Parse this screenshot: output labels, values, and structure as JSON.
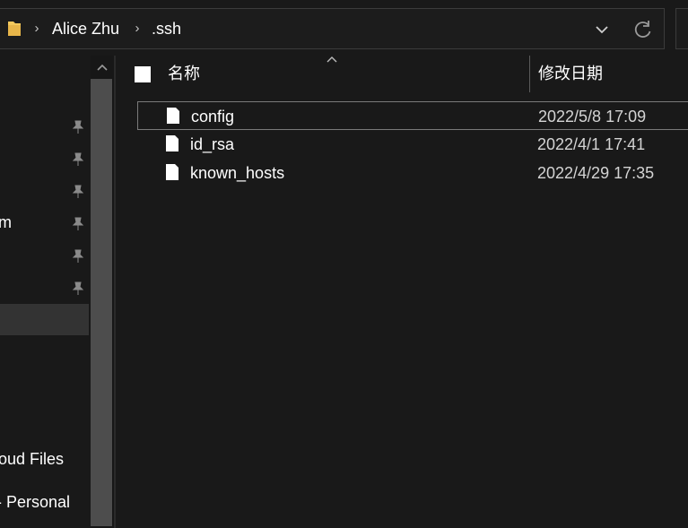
{
  "address_bar": {
    "icon": "folder-icon",
    "breadcrumbs": [
      "Alice Zhu",
      ".ssh"
    ],
    "dropdown_icon": "chevron-down-icon",
    "refresh_icon": "refresh-icon"
  },
  "nav_pane": {
    "visible_labels": {
      "truncated_item": "m",
      "cloud_files": "oud Files",
      "personal": "- Personal"
    },
    "pinned_icon": "pin-icon",
    "pinned_count": 6,
    "scroll_up_icon": "chevron-up-icon"
  },
  "file_list": {
    "columns": {
      "name": "名称",
      "date_modified": "修改日期"
    },
    "sorted_by": "name",
    "files": [
      {
        "name": "config",
        "date": "2022/5/8 17:09",
        "icon": "file-icon",
        "selected": true
      },
      {
        "name": "id_rsa",
        "date": "2022/4/1 17:41",
        "icon": "file-icon",
        "selected": false
      },
      {
        "name": "known_hosts",
        "date": "2022/4/29 17:35",
        "icon": "file-icon",
        "selected": false
      }
    ]
  },
  "colors": {
    "background": "#191919",
    "selection_border": "#7a7a7a",
    "nav_selected": "#333333",
    "folder_yellow": "#f4c95d"
  }
}
